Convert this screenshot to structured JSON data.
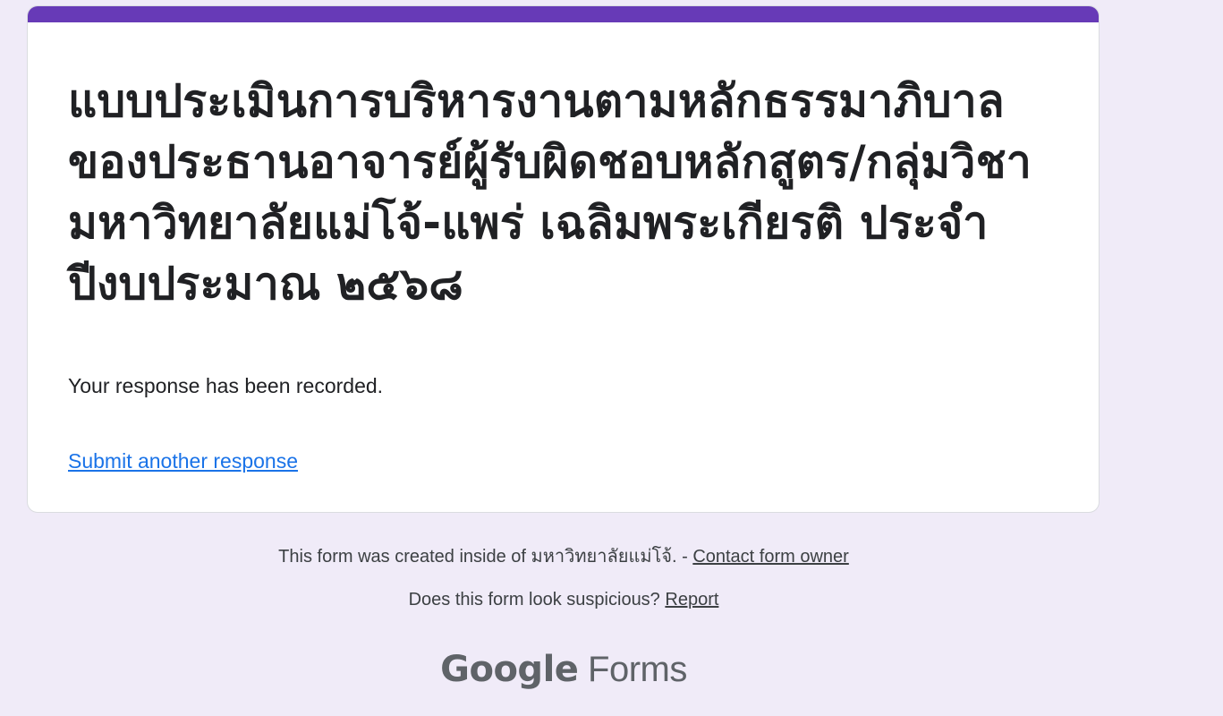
{
  "form": {
    "title": "แบบประเมินการบริหารงานตามหลักธรรมาภิบาลของประธานอาจารย์ผู้รับผิดชอบหลักสูตร/กลุ่มวิชา มหาวิทยาลัยแม่โจ้-แพร่ เฉลิมพระเกียรติ ประจำปีงบประมาณ  ๒๕๖๘",
    "confirmation_message": "Your response has been recorded.",
    "submit_another_label": "Submit another response",
    "accent_color": "#673ab7"
  },
  "footer": {
    "created_text": "This form was created inside of มหาวิทยาลัยแม่โจ้. - ",
    "contact_owner_label": "Contact form owner",
    "suspicious_text": "Does this form look suspicious? ",
    "report_label": "Report"
  },
  "brand": {
    "google": "Google",
    "forms": "Forms"
  }
}
